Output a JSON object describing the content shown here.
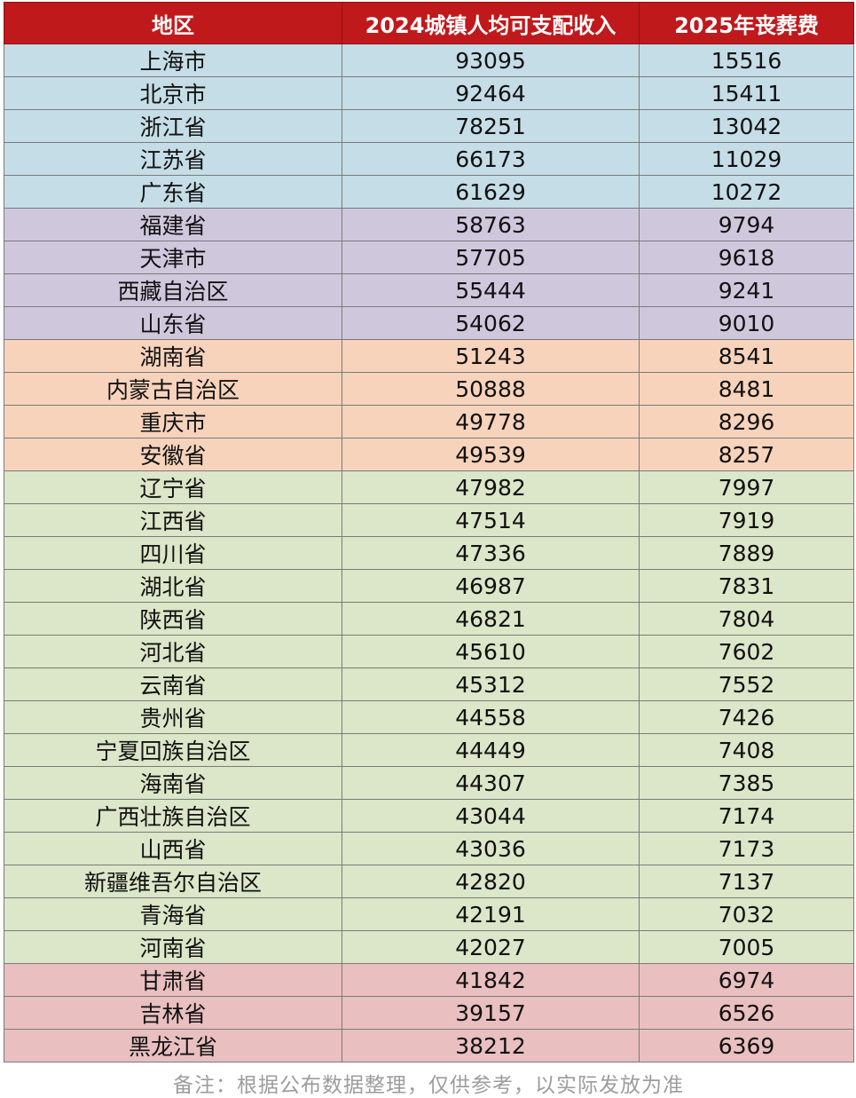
{
  "headers": [
    "地区",
    "2024城镇人均可支配收入",
    "2025年丧葬费"
  ],
  "colors": {
    "header": "#c0191c",
    "blue": "#c5dde6",
    "purple": "#cfc8dd",
    "orange": "#f7d3bc",
    "green": "#dce6c8",
    "pink": "#e9bfc0"
  },
  "rows": [
    {
      "region": "上海市",
      "income": "93095",
      "funeral": "15516",
      "group": "blue"
    },
    {
      "region": "北京市",
      "income": "92464",
      "funeral": "15411",
      "group": "blue"
    },
    {
      "region": "浙江省",
      "income": "78251",
      "funeral": "13042",
      "group": "blue"
    },
    {
      "region": "江苏省",
      "income": "66173",
      "funeral": "11029",
      "group": "blue"
    },
    {
      "region": "广东省",
      "income": "61629",
      "funeral": "10272",
      "group": "blue"
    },
    {
      "region": "福建省",
      "income": "58763",
      "funeral": "9794",
      "group": "purple"
    },
    {
      "region": "天津市",
      "income": "57705",
      "funeral": "9618",
      "group": "purple"
    },
    {
      "region": "西藏自治区",
      "income": "55444",
      "funeral": "9241",
      "group": "purple"
    },
    {
      "region": "山东省",
      "income": "54062",
      "funeral": "9010",
      "group": "purple"
    },
    {
      "region": "湖南省",
      "income": "51243",
      "funeral": "8541",
      "group": "orange"
    },
    {
      "region": "内蒙古自治区",
      "income": "50888",
      "funeral": "8481",
      "group": "orange"
    },
    {
      "region": "重庆市",
      "income": "49778",
      "funeral": "8296",
      "group": "orange"
    },
    {
      "region": "安徽省",
      "income": "49539",
      "funeral": "8257",
      "group": "orange"
    },
    {
      "region": "辽宁省",
      "income": "47982",
      "funeral": "7997",
      "group": "green"
    },
    {
      "region": "江西省",
      "income": "47514",
      "funeral": "7919",
      "group": "green"
    },
    {
      "region": "四川省",
      "income": "47336",
      "funeral": "7889",
      "group": "green"
    },
    {
      "region": "湖北省",
      "income": "46987",
      "funeral": "7831",
      "group": "green"
    },
    {
      "region": "陕西省",
      "income": "46821",
      "funeral": "7804",
      "group": "green"
    },
    {
      "region": "河北省",
      "income": "45610",
      "funeral": "7602",
      "group": "green"
    },
    {
      "region": "云南省",
      "income": "45312",
      "funeral": "7552",
      "group": "green"
    },
    {
      "region": "贵州省",
      "income": "44558",
      "funeral": "7426",
      "group": "green"
    },
    {
      "region": "宁夏回族自治区",
      "income": "44449",
      "funeral": "7408",
      "group": "green"
    },
    {
      "region": "海南省",
      "income": "44307",
      "funeral": "7385",
      "group": "green"
    },
    {
      "region": "广西壮族自治区",
      "income": "43044",
      "funeral": "7174",
      "group": "green"
    },
    {
      "region": "山西省",
      "income": "43036",
      "funeral": "7173",
      "group": "green"
    },
    {
      "region": "新疆维吾尔自治区",
      "income": "42820",
      "funeral": "7137",
      "group": "green"
    },
    {
      "region": "青海省",
      "income": "42191",
      "funeral": "7032",
      "group": "green"
    },
    {
      "region": "河南省",
      "income": "42027",
      "funeral": "7005",
      "group": "green"
    },
    {
      "region": "甘肃省",
      "income": "41842",
      "funeral": "6974",
      "group": "pink"
    },
    {
      "region": "吉林省",
      "income": "39157",
      "funeral": "6526",
      "group": "pink"
    },
    {
      "region": "黑龙江省",
      "income": "38212",
      "funeral": "6369",
      "group": "pink"
    }
  ],
  "note": "备注：根据公布数据整理，仅供参考，以实际发放为准"
}
